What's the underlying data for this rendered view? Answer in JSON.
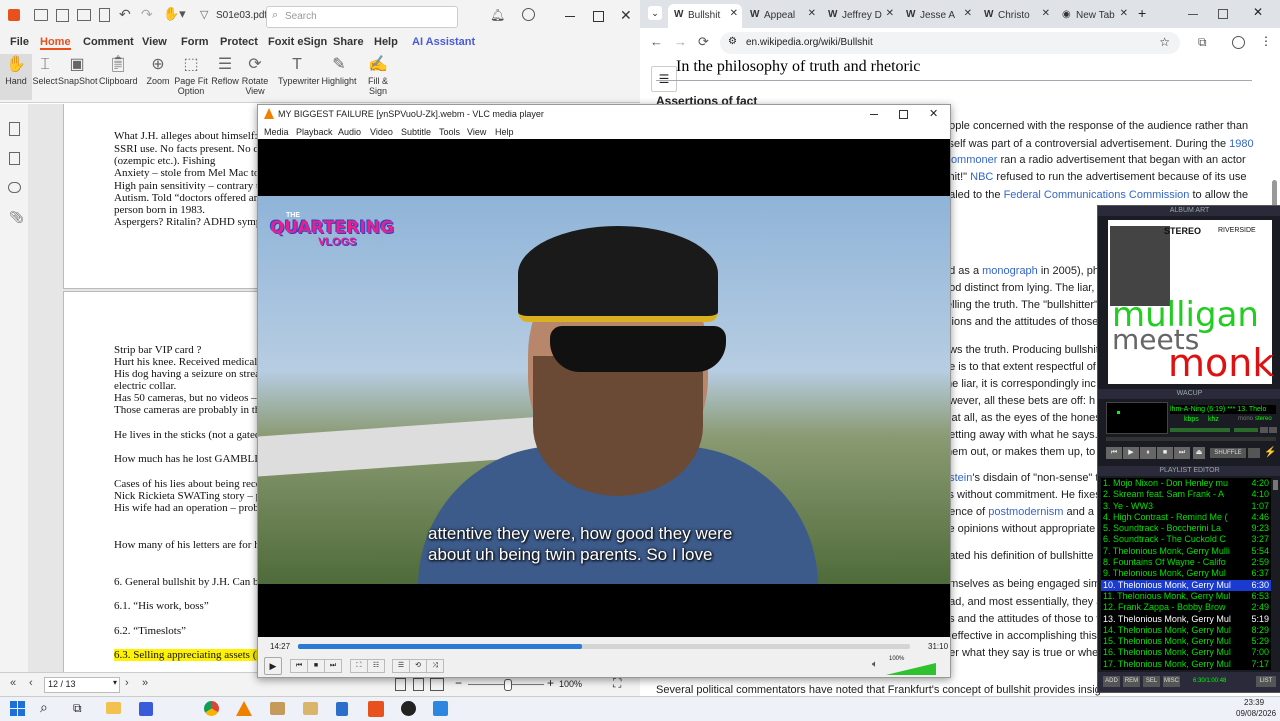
{
  "foxit": {
    "doc_title": "S01e03.pdf *",
    "search_placeholder": "Search",
    "menu": [
      "File",
      "Home",
      "Comment",
      "View",
      "Form",
      "Protect",
      "Foxit eSign",
      "Share",
      "Help",
      "AI Assistant"
    ],
    "ribbon": [
      "Hand",
      "Select",
      "SnapShot",
      "Clipboard",
      "Zoom",
      "Page Fit Option",
      "Reflow",
      "Rotate View",
      "Typewriter",
      "Highlight",
      "Fill & Sign"
    ],
    "page1_lines": [
      "What J.H. alleges about himself:",
      "SSRI use. No facts present. No d",
      "(ozempic etc.). Fishing",
      "Anxiety – stole from Mel Mac to",
      "High pain sensitivity – contrary t",
      "Autism. Told “doctors offered am",
      "person born in 1983.",
      "Aspergers? Ritalin? ADHD symp"
    ],
    "page2_lines": [
      "Strip bar VIP card ?",
      "Hurt his knee. Received medical t",
      "His dog having a seizure on strea",
      "electric collar.",
      "Has 50 cameras, but no videos – l",
      "Those cameras are probably in thi",
      "He lives in the sticks (not a gated",
      "How much has he lost GAMBLIN",
      "Cases of his lies about being reco",
      "Nick Rickieta SWATing story – p",
      "His wife had an operation – prob",
      "How many of his letters are for hi",
      "6. General bullshit by J.H. Can be",
      "6.1. “His work, boss”",
      "6.2. “Timeslots”",
      "6.3. Selling appreciating assets (N"
    ],
    "page_indicator": "12 / 13",
    "zoom": "100%"
  },
  "chrome": {
    "tabs": [
      "Bullshit",
      "Appeal",
      "Jeffrey D",
      "Jesse A",
      "Christo",
      "New Tab"
    ],
    "url": "en.wikipedia.org/wiki/Bullshit",
    "heading": "In the philosophy of truth and rhetoric",
    "subheading": "Assertions of fact",
    "wiki_lines": [
      {
        "pre": "eople concerned with the response of the audience rather than",
        "link": "",
        "post": ""
      },
      {
        "pre": " itself was part of a controversial advertisement. During the ",
        "link": "1980",
        "post": ""
      },
      {
        "pre": "",
        "link": "Commoner",
        "post": " ran a radio advertisement that began with an actor"
      },
      {
        "pre": "shit!\" ",
        "link": "NBC",
        "post": " refused to run the advertisement because of its use"
      },
      {
        "pre": "ealed to the ",
        "link": "Federal Communications Commission",
        "post": " to allow the"
      },
      {
        "pre": "ed as a ",
        "link": "monograph",
        "post": " in 2005), ph"
      },
      {
        "pre": "ood distinct from lying. The liar, h",
        "link": "",
        "post": ""
      },
      {
        "pre": "telling the truth. The \"bullshitter\"",
        "link": "",
        "post": ""
      },
      {
        "pre": "inions and the attitudes of those",
        "link": "",
        "post": ""
      },
      {
        "pre": "ows the truth. Producing bullshit",
        "link": "",
        "post": ""
      },
      {
        "pre": "he is to that extent respectful of",
        "link": "",
        "post": ""
      },
      {
        "pre": " the liar, it is correspondingly inc",
        "link": "",
        "post": ""
      },
      {
        "pre": "owever, all these bets are off: h",
        "link": "",
        "post": ""
      },
      {
        "pre": "s at all, as the eyes of the hones",
        "link": "",
        "post": ""
      },
      {
        "pre": "getting away with what he says.",
        "link": "",
        "post": ""
      },
      {
        "pre": " them out, or makes them up, to",
        "link": "",
        "post": ""
      },
      {
        "pre": "",
        "link": "nstein",
        "post": "'s disdain of \"non-sense\" t"
      },
      {
        "pre": "ys without commitment. He fixes",
        "link": "",
        "post": ""
      },
      {
        "pre": "uence of ",
        "link": "postmodernism",
        "post": " and a"
      },
      {
        "pre": "ve opinions without appropriate",
        "link": "",
        "post": ""
      },
      {
        "pre": "dated his definition of bullshitte",
        "link": "",
        "post": ""
      },
      {
        "pre": "emselves as being engaged sim",
        "link": "",
        "post": ""
      },
      {
        "pre": "ead, and most essentially, they a",
        "link": "",
        "post": ""
      },
      {
        "pre": "ns and the attitudes of those to w",
        "link": "",
        "post": ""
      },
      {
        "pre": "s effective in accomplishing this",
        "link": "",
        "post": ""
      },
      {
        "pre": "her what they say is true or whe",
        "link": "",
        "post": ""
      }
    ],
    "footer_line": "Several political commentators have noted that Frankfurt's concept of bullshit provides insight"
  },
  "vlc": {
    "title": "MY BIGGEST FAILURE [ynSPVuoU-Zk].webm - VLC media player",
    "menu": [
      "Media",
      "Playback",
      "Audio",
      "Video",
      "Subtitle",
      "Tools",
      "View",
      "Help"
    ],
    "logo_line1": "THE",
    "logo_line2": "QUARTERING",
    "logo_line3": "VLOGS",
    "subtitle_line1": "attentive they were, how good they were",
    "subtitle_line2": "about uh being twin parents. So I love",
    "elapsed": "14:27",
    "total": "31:10",
    "progress": 0.464,
    "volume": "100%",
    "volume_level": 1.0
  },
  "winamp": {
    "album_art_title": "ALBUM ART",
    "art_top": "STEREO",
    "art_label": "RIVERSIDE",
    "art_word1": "mulligan",
    "art_word2": "meets",
    "art_word3": "monk",
    "player_title": "WACUP",
    "marquee": "lhm-A-Ning (6:19) *** 13. Thelo",
    "kbps": "kbps",
    "khz": "khz",
    "mode1": "mono",
    "mode2": "stereo",
    "shuffle": "SHUFFLE",
    "playlist_title": "PLAYLIST EDITOR",
    "playlist": [
      {
        "t": "1. Mojo Nixon - Don Henley mu",
        "d": "4:20"
      },
      {
        "t": "2. Skream feat. Sam Frank - A",
        "d": "4:10"
      },
      {
        "t": "3. Ye - WW3",
        "d": "1:07"
      },
      {
        "t": "4. High Contrast - Remind Me (",
        "d": "4:46"
      },
      {
        "t": "5. Soundtrack - Boccherini La",
        "d": "9:23"
      },
      {
        "t": "6. Soundtrack - The Cuckold C",
        "d": "3:27"
      },
      {
        "t": "7. Thelonious Monk, Gerry Mulli",
        "d": "5:54"
      },
      {
        "t": "8. Fountains Of Wayne - Califo",
        "d": "2:59"
      },
      {
        "t": "9. Thelonious Monk, Gerry Mul",
        "d": "6:37"
      },
      {
        "t": "10. Thelonious Monk, Gerry Mul",
        "d": "6:30"
      },
      {
        "t": "11. Thelonious Monk, Gerry Mul",
        "d": "6:53"
      },
      {
        "t": "12. Frank Zappa - Bobby Brow",
        "d": "2:49"
      },
      {
        "t": "13. Thelonious Monk, Gerry Mul",
        "d": "5:19"
      },
      {
        "t": "14. Thelonious Monk, Gerry Mul",
        "d": "8:29"
      },
      {
        "t": "15. Thelonious Monk, Gerry Mul",
        "d": "5:29"
      },
      {
        "t": "16. Thelonious Monk, Gerry Mul",
        "d": "7:00"
      },
      {
        "t": "17. Thelonious Monk, Gerry Mul",
        "d": "7:17"
      }
    ],
    "selected_index": 9,
    "playing_index": 12,
    "pl_buttons": [
      "ADD",
      "REM",
      "SEL",
      "MISC",
      "LIST"
    ],
    "pl_time": "6:30/1:00:48"
  },
  "taskbar": {
    "time": "23:39",
    "date": "09/08/2026"
  },
  "colors": {
    "foxit_accent": "#e8501c",
    "vlc_progress": "#2b7bd6",
    "winamp_green": "#00e000",
    "winamp_selected": "#ffffff",
    "wiki_link": "#3366cc",
    "highlight": "#fff200"
  }
}
